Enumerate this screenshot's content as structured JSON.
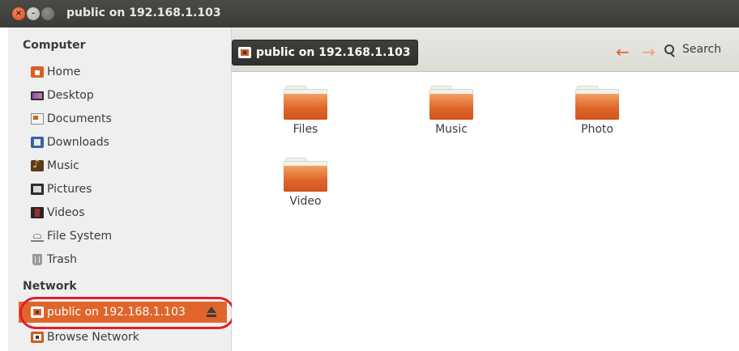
{
  "window": {
    "title": "public on 192.168.1.103",
    "controls": [
      "close-icon",
      "minimize-icon",
      "maximize-icon"
    ]
  },
  "sidebar": {
    "computer_heading": "Computer",
    "computer_items": [
      {
        "label": "Home",
        "icon": "home-folder-icon"
      },
      {
        "label": "Desktop",
        "icon": "desktop-icon"
      },
      {
        "label": "Documents",
        "icon": "documents-icon"
      },
      {
        "label": "Downloads",
        "icon": "downloads-icon"
      },
      {
        "label": "Music",
        "icon": "music-icon"
      },
      {
        "label": "Pictures",
        "icon": "pictures-icon"
      },
      {
        "label": "Videos",
        "icon": "videos-icon"
      },
      {
        "label": "File System",
        "icon": "file-system-icon"
      },
      {
        "label": "Trash",
        "icon": "trash-icon"
      }
    ],
    "network_heading": "Network",
    "network_items": [
      {
        "label": "public on 192.168.1.103",
        "icon": "network-share-icon",
        "selected": true,
        "eject_icon": "eject-icon"
      },
      {
        "label": "Browse Network",
        "icon": "network-share-icon",
        "selected": false
      }
    ]
  },
  "toolbar": {
    "location": "public on 192.168.1.103",
    "back_icon": "back-arrow-icon",
    "forward_icon": "forward-arrow-icon",
    "search_label": "Search"
  },
  "folders": [
    {
      "label": "Files"
    },
    {
      "label": "Music"
    },
    {
      "label": "Photo"
    },
    {
      "label": "Video"
    }
  ],
  "colors": {
    "accent": "#e0652b",
    "highlight_outline": "#e01e2e",
    "titlebar": "#3c3b37"
  }
}
